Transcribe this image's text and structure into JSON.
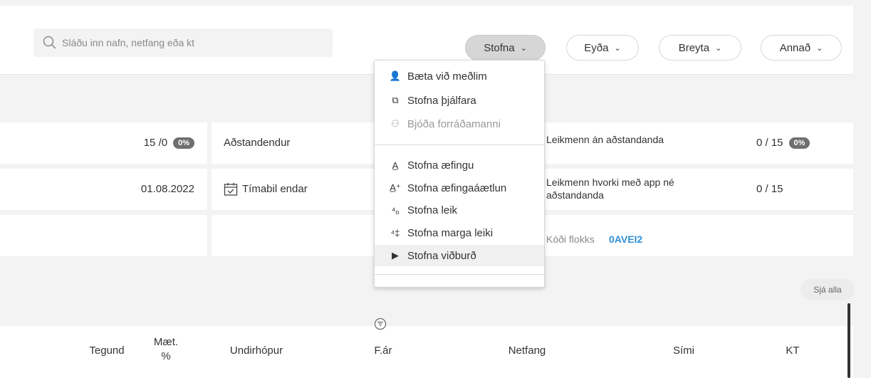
{
  "search": {
    "placeholder": "Sláðu inn nafn, netfang eða kt"
  },
  "actions": {
    "stofna": "Stofna",
    "eyda": "Eyða",
    "breyta": "Breyta",
    "annad": "Annað"
  },
  "stats": {
    "row1": {
      "value": "15 /0",
      "badge": "0%",
      "label": "Aðstandendur",
      "right_label": "Leikmenn án aðstandanda",
      "right_value": "0 / 15",
      "right_badge": "0%"
    },
    "row2": {
      "value": "01.08.2022",
      "label": "Tímabil endar",
      "right_label": "Leikmenn hvorki með app né aðstandanda",
      "right_value": "0 / 15"
    },
    "row3": {
      "code_label": "Kóði flokks",
      "code_value": "0AVEI2"
    }
  },
  "menu": {
    "items": [
      {
        "label": "Bæta við meðlim",
        "icon": "add-person-icon"
      },
      {
        "label": "Stofna þjálfara",
        "icon": "coach-icon"
      },
      {
        "label": "Bjóða forráðamanni",
        "icon": "invite-guardian-icon",
        "disabled": true
      },
      {
        "label": "Stofna æfingu",
        "icon": "practice-icon"
      },
      {
        "label": "Stofna æfingaáætlun",
        "icon": "practice-plan-icon"
      },
      {
        "label": "Stofna leik",
        "icon": "game-icon"
      },
      {
        "label": "Stofna marga leiki",
        "icon": "multiple-games-icon"
      },
      {
        "label": "Stofna viðburð",
        "icon": "play-icon"
      }
    ]
  },
  "see_all": "Sjá alla",
  "table": {
    "headers": [
      "Tegund",
      "Mæt. %",
      "Undirhópur",
      "F.ár",
      "Netfang",
      "Sími",
      "KT"
    ]
  }
}
